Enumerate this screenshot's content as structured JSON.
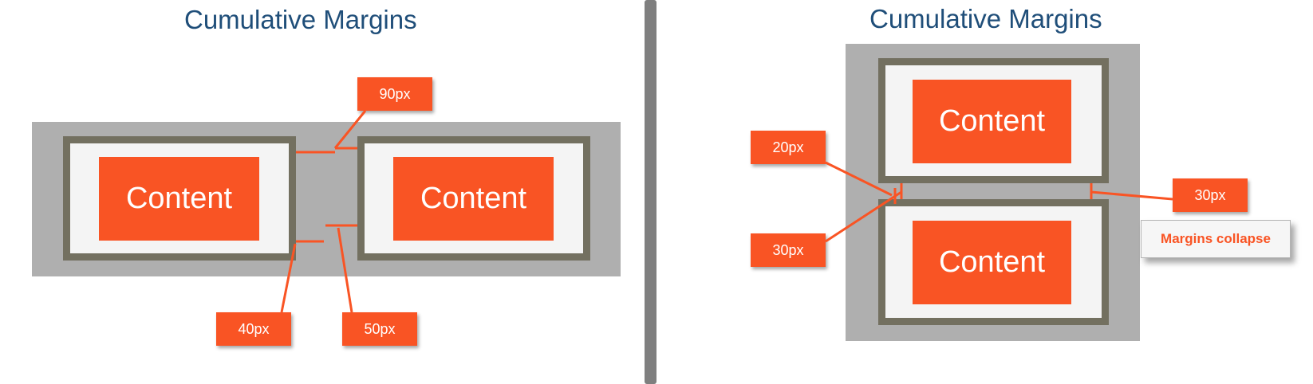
{
  "left_panel": {
    "title": "Cumulative Margins",
    "boxes": [
      "Content",
      "Content"
    ],
    "labels": {
      "top_gap": "90px",
      "left_margin": "40px",
      "right_margin": "50px"
    }
  },
  "right_panel": {
    "title": "Cumulative Margins",
    "boxes": [
      "Content",
      "Content"
    ],
    "labels": {
      "bottom_margin_top_box": "20px",
      "top_margin_bottom_box": "30px",
      "collapsed": "30px"
    },
    "note": "Margins collapse"
  },
  "colors": {
    "accent": "#f95424",
    "title": "#1f4e79",
    "container": "#afafaf",
    "frame_border": "#737060",
    "frame_fill": "#f4f4f4",
    "divider": "#7f7f7f"
  }
}
